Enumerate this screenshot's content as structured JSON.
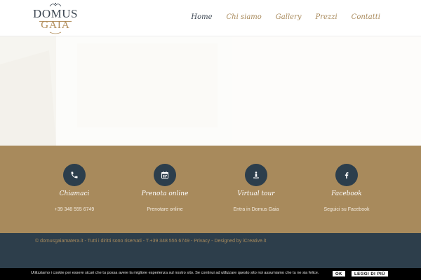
{
  "header": {
    "logo_line1": "DOMUS",
    "logo_line2": "GAIA",
    "nav": [
      {
        "label": "Home",
        "active": true
      },
      {
        "label": "Chi siamo"
      },
      {
        "label": "Gallery"
      },
      {
        "label": "Prezzi"
      },
      {
        "label": "Contatti"
      }
    ]
  },
  "contacts": [
    {
      "icon": "phone-icon",
      "title": "Chiamaci",
      "subtitle": "+39 348 555 6749"
    },
    {
      "icon": "calendar-icon",
      "title": "Prenota online",
      "subtitle": "Prenotare online"
    },
    {
      "icon": "street-view-icon",
      "title": "Virtual tour",
      "subtitle": "Entra in Domus Gaia"
    },
    {
      "icon": "facebook-icon",
      "title": "Facebook",
      "subtitle": "Seguici su Facebook"
    }
  ],
  "footer": {
    "copyright": "© domusgaiamatera.it - Tutti i diritti sono riservati - T.+39 348 555 6749 - Privacy - Designed by iCreative.it"
  },
  "cookie_bar": {
    "message": "Utilizziamo i cookie per essere sicuri che tu possa avere la migliore esperienza sul nostro sito. Se continui ad utilizzare questo sito noi assumiamo che tu ne sia felice.",
    "ok_label": "OK",
    "more_label": "LEGGI DI PIÙ"
  },
  "colors": {
    "gold": "#a88a5c",
    "navy": "#2d3e4b",
    "cookie_bg": "#000000"
  }
}
